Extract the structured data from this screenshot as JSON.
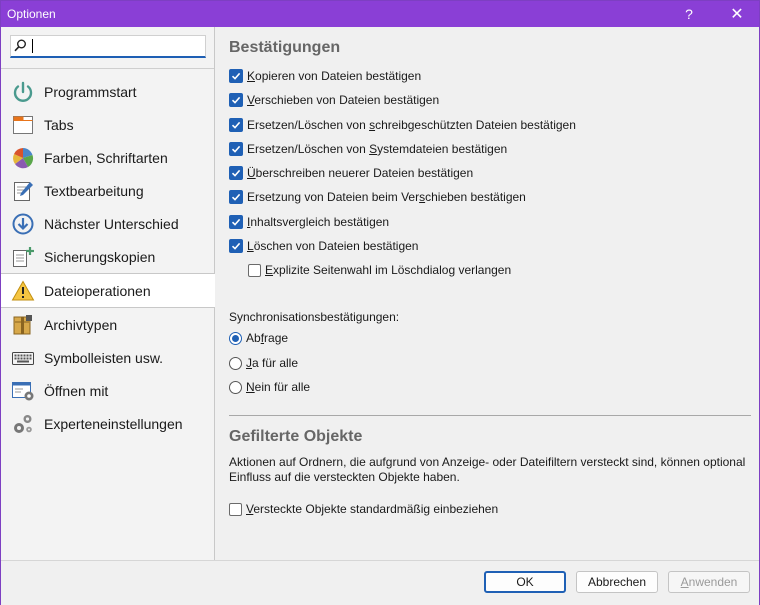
{
  "window": {
    "title": "Optionen",
    "help": "?",
    "close": "✕"
  },
  "search": {
    "placeholder": ""
  },
  "sidebar": {
    "items": [
      {
        "label": "Programmstart",
        "icon": "power-icon"
      },
      {
        "label": "Tabs",
        "icon": "tabs-icon"
      },
      {
        "label": "Farben, Schriftarten",
        "icon": "palette-icon"
      },
      {
        "label": "Textbearbeitung",
        "icon": "edit-document-icon"
      },
      {
        "label": "Nächster Unterschied",
        "icon": "next-down-arrow-icon"
      },
      {
        "label": "Sicherungskopien",
        "icon": "backup-document-icon"
      },
      {
        "label": "Dateioperationen",
        "icon": "warning-icon",
        "active": true
      },
      {
        "label": "Archivtypen",
        "icon": "archive-icon"
      },
      {
        "label": "Symbolleisten usw.",
        "icon": "keyboard-icon"
      },
      {
        "label": "Öffnen mit",
        "icon": "open-with-icon"
      },
      {
        "label": "Experteneinstellungen",
        "icon": "gears-icon"
      }
    ]
  },
  "confirmations": {
    "heading": "Bestätigungen",
    "items": [
      {
        "mn": "K",
        "rest": "opieren von Dateien bestätigen",
        "pre": "",
        "checked": true
      },
      {
        "mn": "V",
        "rest": "erschieben von Dateien bestätigen",
        "pre": "",
        "checked": true
      },
      {
        "pre": "Ersetzen/Löschen von ",
        "mn": "s",
        "rest": "chreibgeschützten Dateien bestätigen",
        "checked": true
      },
      {
        "pre": "Ersetzen/Löschen von ",
        "mn": "S",
        "rest": "ystemdateien bestätigen",
        "checked": true
      },
      {
        "pre": "",
        "mn": "Ü",
        "rest": "berschreiben neuerer Dateien bestätigen",
        "checked": true
      },
      {
        "pre": "Ersetzung von Dateien beim Ver",
        "mn": "s",
        "rest": "chieben bestätigen",
        "checked": true
      },
      {
        "pre": "",
        "mn": "I",
        "rest": "nhaltsvergleich bestätigen",
        "checked": true
      },
      {
        "pre": "",
        "mn": "L",
        "rest": "öschen von Dateien bestätigen",
        "checked": true
      },
      {
        "pre": "",
        "mn": "E",
        "rest": "xplizite Seitenwahl im Löschdialog verlangen",
        "checked": false
      }
    ]
  },
  "sync": {
    "label": "Synchronisationsbestätigungen:",
    "options": [
      {
        "pre": "Ab",
        "mn": "f",
        "rest": "rage",
        "selected": true
      },
      {
        "pre": "",
        "mn": "J",
        "rest": "a für alle",
        "selected": false
      },
      {
        "pre": "",
        "mn": "N",
        "rest": "ein für alle",
        "selected": false
      }
    ]
  },
  "filtered": {
    "heading": "Gefilterte Objekte",
    "description": "Aktionen auf Ordnern, die aufgrund von Anzeige- oder Dateifiltern versteckt sind, können optional Einfluss auf die versteckten Objekte haben.",
    "checkbox": {
      "pre": "",
      "mn": "V",
      "rest": "ersteckte Objekte standardmäßig einbeziehen",
      "checked": false
    }
  },
  "buttons": {
    "ok": "OK",
    "cancel": "Abbrechen",
    "apply_pre": "",
    "apply_mn": "A",
    "apply_rest": "nwenden"
  },
  "colors": {
    "titlebar": "#8a3fd6",
    "accent": "#1f60b5"
  }
}
